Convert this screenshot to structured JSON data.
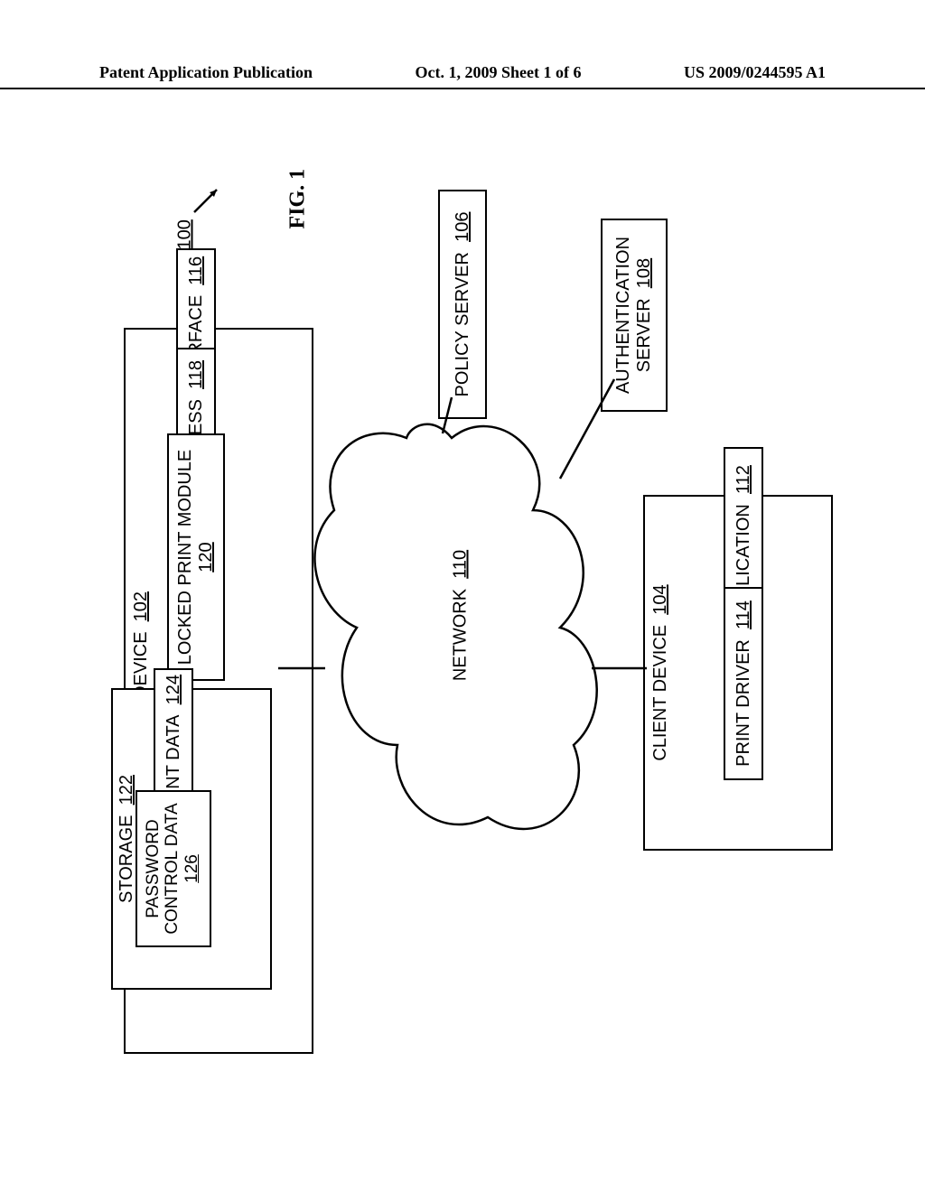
{
  "header": {
    "left": "Patent Application Publication",
    "middle": "Oct. 1, 2009   Sheet 1 of 6",
    "right": "US 2009/0244595 A1"
  },
  "figure": {
    "title": "FIG. 1",
    "ref": "100"
  },
  "nodes": {
    "printing_device": {
      "label": "PRINTING DEVICE",
      "num": "102"
    },
    "user_interface": {
      "label": "USER INTERFACE",
      "num": "116"
    },
    "print_process": {
      "label": "PRINT PROCESS",
      "num": "118"
    },
    "locked_print_module": {
      "label": "LOCKED PRINT MODULE",
      "num": "120"
    },
    "storage": {
      "label": "STORAGE",
      "num": "122"
    },
    "print_data": {
      "label": "PRINT DATA",
      "num": "124"
    },
    "password_ctrl": {
      "label": "PASSWORD CONTROL DATA",
      "num": "126"
    },
    "policy_server": {
      "label": "POLICY SERVER",
      "num": "106"
    },
    "auth_server": {
      "label1": "AUTHENTICATION",
      "label2": "SERVER",
      "num": "108"
    },
    "network": {
      "label": "NETWORK",
      "num": "110"
    },
    "client_device": {
      "label": "CLIENT DEVICE",
      "num": "104"
    },
    "application": {
      "label": "APPLICATION",
      "num": "112"
    },
    "print_driver": {
      "label": "PRINT DRIVER",
      "num": "114"
    }
  }
}
